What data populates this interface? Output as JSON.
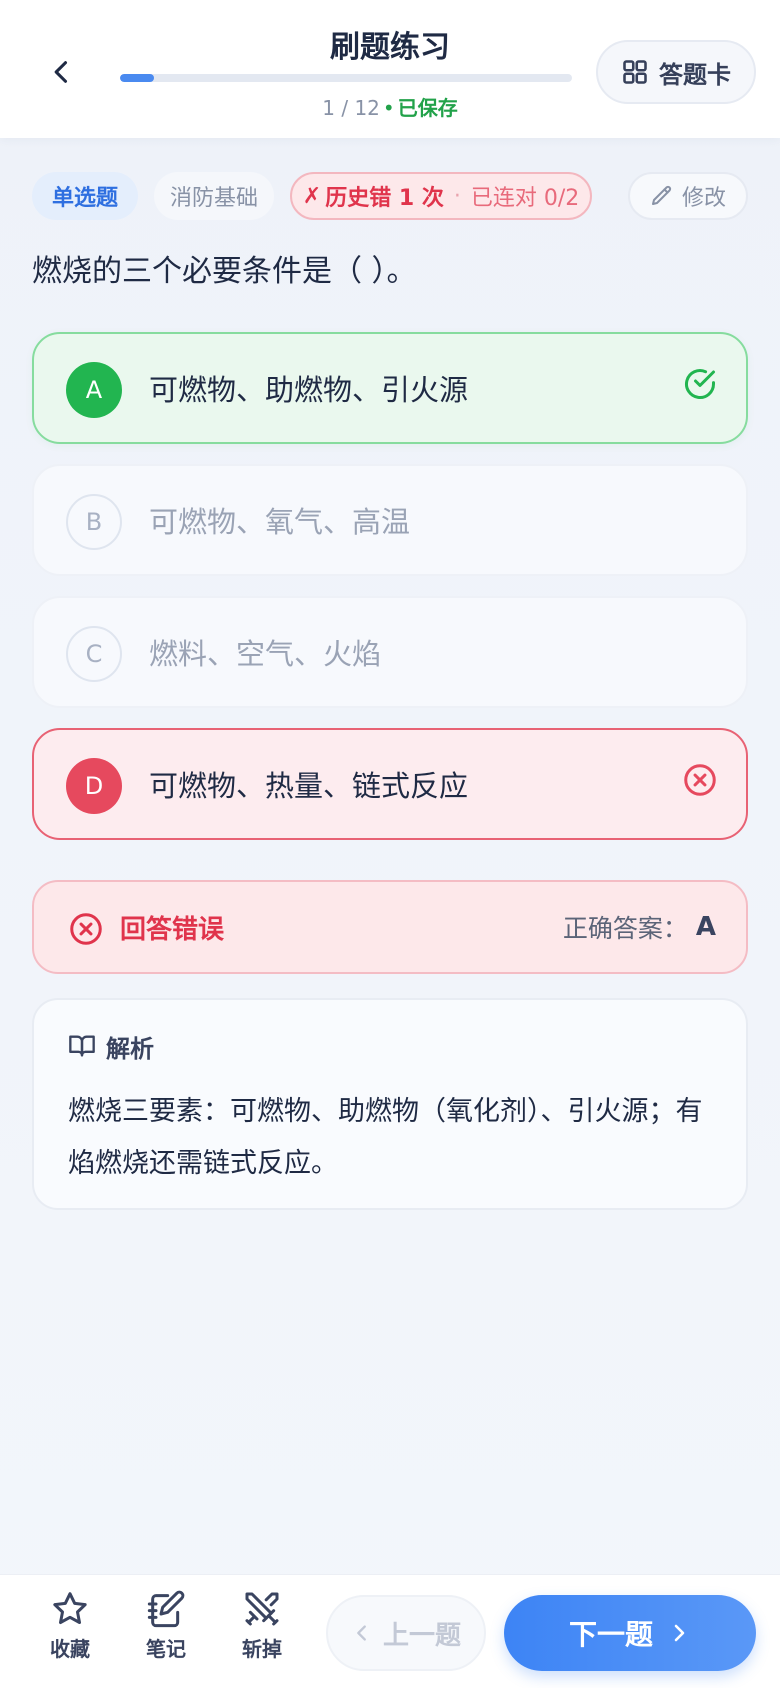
{
  "header": {
    "title": "刷题练习",
    "progress_current": 1,
    "progress_total": 12,
    "progress_text": "1 / 12",
    "progress_fraction": 0.075,
    "dot": "•",
    "saved_label": "已保存",
    "answer_card_label": "答题卡"
  },
  "tags": {
    "type_label": "单选题",
    "category_label": "消防基础",
    "history_mark": "✗",
    "history_label": "历史错 1 次",
    "separator": "·",
    "streak_label": "已连对 0/2",
    "edit_label": "修改"
  },
  "question": {
    "text": "燃烧的三个必要条件是（ ）。"
  },
  "options": [
    {
      "letter": "A",
      "text": "可燃物、助燃物、引火源",
      "state": "correct"
    },
    {
      "letter": "B",
      "text": "可燃物、氧气、高温",
      "state": "neutral"
    },
    {
      "letter": "C",
      "text": "燃料、空气、火焰",
      "state": "neutral"
    },
    {
      "letter": "D",
      "text": "可燃物、热量、链式反应",
      "state": "wrong"
    }
  ],
  "result": {
    "label": "回答错误",
    "correct_answer_label": "正确答案：",
    "correct_answer_value": "A"
  },
  "explanation": {
    "title": "解析",
    "text": "燃烧三要素：可燃物、助燃物（氧化剂）、引火源；有焰燃烧还需链式反应。"
  },
  "bottom": {
    "favorite_label": "收藏",
    "note_label": "笔记",
    "cut_label": "斩掉",
    "prev_label": "上一题",
    "next_label": "下一题"
  },
  "colors": {
    "accent_blue": "#3d84f5",
    "correct_green": "#22b550",
    "wrong_red": "#e6495e",
    "text_dark": "#1f2a44"
  },
  "icons": {
    "back": "chevron-left-icon",
    "answer_card": "grid-icon",
    "edit": "pencil-icon",
    "correct": "check-circle-icon",
    "wrong": "x-circle-icon",
    "explanation": "book-open-icon",
    "favorite": "star-icon",
    "note": "notebook-pen-icon",
    "cut": "crossed-swords-icon",
    "prev": "chevron-left-icon",
    "next": "chevron-right-icon"
  }
}
